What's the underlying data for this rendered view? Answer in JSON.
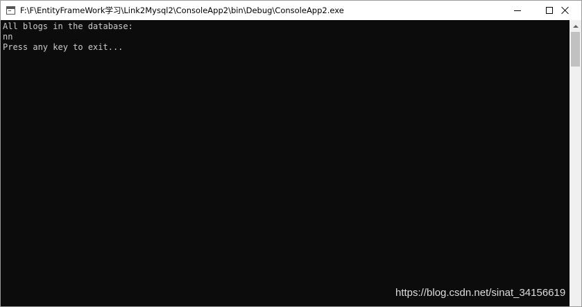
{
  "window": {
    "title": "F:\\F\\EntityFrameWork学习\\Link2Mysql2\\ConsoleApp2\\bin\\Debug\\ConsoleApp2.exe"
  },
  "console": {
    "lines": [
      "All blogs in the database:",
      "nn",
      "Press any key to exit..."
    ]
  },
  "watermark": "https://blog.csdn.net/sinat_34156619",
  "colors": {
    "console_bg": "#0c0c0c",
    "console_text": "#cccccc",
    "titlebar_bg": "#ffffff"
  }
}
